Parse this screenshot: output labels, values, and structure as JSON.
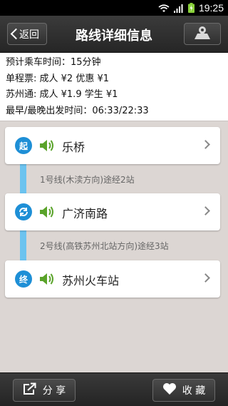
{
  "status_bar": {
    "time": "19:25"
  },
  "header": {
    "back_label": "返回",
    "title": "路线详细信息",
    "map_icon": "map-pin-icon"
  },
  "info": {
    "lines": [
      "预计乘车时间：15分钟",
      "单程票: 成人 ¥2 优惠 ¥1",
      "苏州通: 成人 ¥1.9 学生 ¥1",
      "最早/最晚出发时间：06:33/22:33"
    ]
  },
  "route": {
    "line_color": "#6cc3ef",
    "stops": [
      {
        "badge": "起",
        "name": "乐桥"
      },
      {
        "badge": "⟳",
        "name": "广济南路"
      },
      {
        "badge": "终",
        "name": "苏州火车站"
      }
    ],
    "segments": [
      "1号线(木渎方向)途经2站",
      "2号线(高铁苏州北站方向)途经3站"
    ]
  },
  "footer": {
    "share_label": "分 享",
    "favorite_label": "收 藏"
  }
}
